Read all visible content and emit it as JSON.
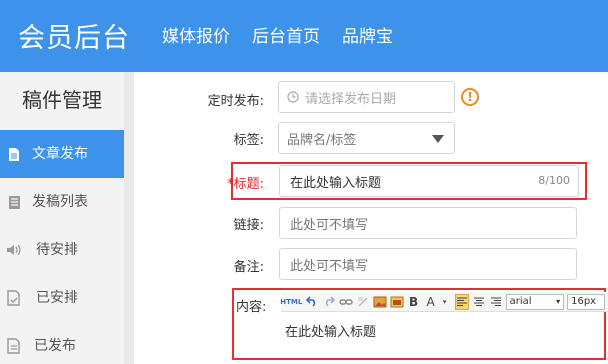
{
  "header": {
    "title": "会员后台",
    "nav": [
      "媒体报价",
      "后台首页",
      "品牌宝"
    ]
  },
  "sidebar": {
    "title": "稿件管理",
    "items": [
      {
        "label": "文章发布",
        "icon": "document-icon",
        "active": true
      },
      {
        "label": "发稿列表",
        "icon": "list-icon",
        "active": false
      },
      {
        "label": "待安排",
        "icon": "speaker-icon",
        "active": false
      },
      {
        "label": "已安排",
        "icon": "checked-doc-icon",
        "active": false
      },
      {
        "label": "已发布",
        "icon": "published-doc-icon",
        "active": false
      }
    ]
  },
  "form": {
    "schedule": {
      "label": "定时发布:",
      "placeholder": "请选择发布日期"
    },
    "tags": {
      "label": "标签:",
      "placeholder": "品牌名/标签"
    },
    "title": {
      "required_mark": "*",
      "label": "标题:",
      "value": "在此处输入标题",
      "counter": "8/100"
    },
    "link": {
      "label": "链接:",
      "placeholder": "此处可不填写"
    },
    "note": {
      "label": "备注:",
      "placeholder": "此处可不填写"
    },
    "content": {
      "label": "内容:",
      "toolbar": {
        "html": "HTML",
        "bold": "B",
        "font_letter": "A",
        "font_family": "arial",
        "font_size": "16px"
      },
      "body_text": "在此处输入标题"
    }
  },
  "colors": {
    "primary": "#3d92ea",
    "highlight_frame": "#e03030",
    "info": "#f08a1c"
  }
}
